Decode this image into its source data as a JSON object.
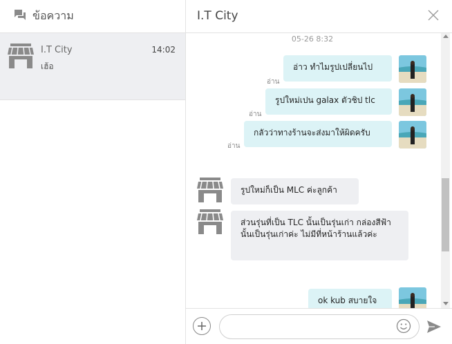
{
  "left": {
    "title": "ข้อความ",
    "conversations": [
      {
        "name": "I.T City",
        "time": "14:02",
        "preview": "เฮ้อ"
      }
    ]
  },
  "chat": {
    "title": "I.T City",
    "date": "05-26 8:32",
    "messages": [
      {
        "text": "อ่าว ทำไมรูปเปลี่ยนไป",
        "read": "อ่าน"
      },
      {
        "text": "รูปใหม่เปน galax ตัวชิป tlc",
        "read": "อ่าน"
      },
      {
        "text": "กลัวว่าทางร้านจะส่งมาให้ผิดครับ",
        "read": "อ่าน"
      },
      {
        "text": "รูปใหม่ก็เป็น MLC ค่ะลูกค้า"
      },
      {
        "text": "ส่วนรุ่นที่เป็น TLC นั้นเป็นรุ่นเก่า กล่องสีฟ้านั้นเป็นรุ่นเก่าค่ะ ไม่มีที่หน้าร้านแล้วค่ะ"
      },
      {
        "text": "ok kub สบายใจ"
      }
    ],
    "input_placeholder": ""
  },
  "colors": {
    "outgoing": "#dcf3f6",
    "incoming": "#eeeff2",
    "icon": "#8a8a8a"
  },
  "icons": {
    "header": "chat-bubbles-icon",
    "shop": "storefront-icon",
    "close": "close-icon",
    "add": "plus-icon",
    "emoji": "smiley-icon",
    "send": "send-icon"
  }
}
